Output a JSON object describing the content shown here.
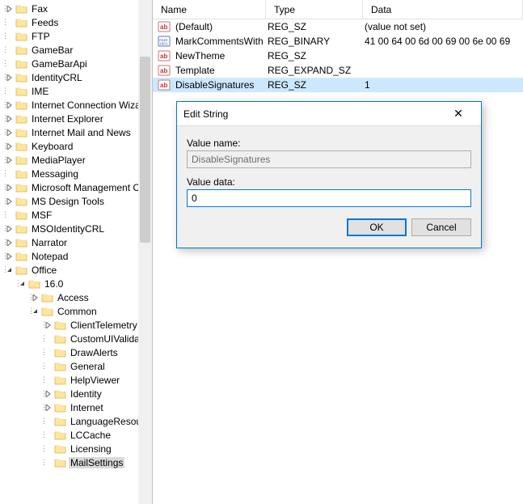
{
  "tree": {
    "items": [
      {
        "depth": 0,
        "exp": "closed",
        "label": "Fax"
      },
      {
        "depth": 0,
        "exp": "none",
        "label": "Feeds"
      },
      {
        "depth": 0,
        "exp": "none",
        "label": "FTP"
      },
      {
        "depth": 0,
        "exp": "none",
        "label": "GameBar"
      },
      {
        "depth": 0,
        "exp": "none",
        "label": "GameBarApi"
      },
      {
        "depth": 0,
        "exp": "closed",
        "label": "IdentityCRL"
      },
      {
        "depth": 0,
        "exp": "none",
        "label": "IME"
      },
      {
        "depth": 0,
        "exp": "closed",
        "label": "Internet Connection Wizard"
      },
      {
        "depth": 0,
        "exp": "closed",
        "label": "Internet Explorer"
      },
      {
        "depth": 0,
        "exp": "closed",
        "label": "Internet Mail and News"
      },
      {
        "depth": 0,
        "exp": "closed",
        "label": "Keyboard"
      },
      {
        "depth": 0,
        "exp": "closed",
        "label": "MediaPlayer"
      },
      {
        "depth": 0,
        "exp": "none",
        "label": "Messaging"
      },
      {
        "depth": 0,
        "exp": "closed",
        "label": "Microsoft Management Con"
      },
      {
        "depth": 0,
        "exp": "closed",
        "label": "MS Design Tools"
      },
      {
        "depth": 0,
        "exp": "none",
        "label": "MSF"
      },
      {
        "depth": 0,
        "exp": "closed",
        "label": "MSOIdentityCRL"
      },
      {
        "depth": 0,
        "exp": "closed",
        "label": "Narrator"
      },
      {
        "depth": 0,
        "exp": "closed",
        "label": "Notepad"
      },
      {
        "depth": 0,
        "exp": "open",
        "label": "Office"
      },
      {
        "depth": 1,
        "exp": "open",
        "label": "16.0"
      },
      {
        "depth": 2,
        "exp": "closed",
        "label": "Access"
      },
      {
        "depth": 2,
        "exp": "open",
        "label": "Common"
      },
      {
        "depth": 3,
        "exp": "closed",
        "label": "ClientTelemetry"
      },
      {
        "depth": 3,
        "exp": "none",
        "label": "CustomUIValidat"
      },
      {
        "depth": 3,
        "exp": "none",
        "label": "DrawAlerts"
      },
      {
        "depth": 3,
        "exp": "none",
        "label": "General"
      },
      {
        "depth": 3,
        "exp": "none",
        "label": "HelpViewer"
      },
      {
        "depth": 3,
        "exp": "closed",
        "label": "Identity"
      },
      {
        "depth": 3,
        "exp": "closed",
        "label": "Internet"
      },
      {
        "depth": 3,
        "exp": "none",
        "label": "LanguageResourc"
      },
      {
        "depth": 3,
        "exp": "none",
        "label": "LCCache"
      },
      {
        "depth": 3,
        "exp": "none",
        "label": "Licensing"
      },
      {
        "depth": 3,
        "exp": "none",
        "label": "MailSettings",
        "selected": true
      }
    ]
  },
  "list": {
    "columns": {
      "name": "Name",
      "type": "Type",
      "data": "Data"
    },
    "rows": [
      {
        "icon": "ab",
        "name": "(Default)",
        "type": "REG_SZ",
        "data": "(value not set)"
      },
      {
        "icon": "bin",
        "name": "MarkCommentsWith",
        "type": "REG_BINARY",
        "data": "41 00 64 00 6d 00 69 00 6e 00 69"
      },
      {
        "icon": "ab",
        "name": "NewTheme",
        "type": "REG_SZ",
        "data": ""
      },
      {
        "icon": "ab",
        "name": "Template",
        "type": "REG_EXPAND_SZ",
        "data": ""
      },
      {
        "icon": "ab",
        "name": "DisableSignatures",
        "type": "REG_SZ",
        "data": "1",
        "selected": true
      }
    ]
  },
  "dialog": {
    "title": "Edit String",
    "valueNameLabel": "Value name:",
    "valueName": "DisableSignatures",
    "valueDataLabel": "Value data:",
    "valueData": "0",
    "ok": "OK",
    "cancel": "Cancel"
  }
}
